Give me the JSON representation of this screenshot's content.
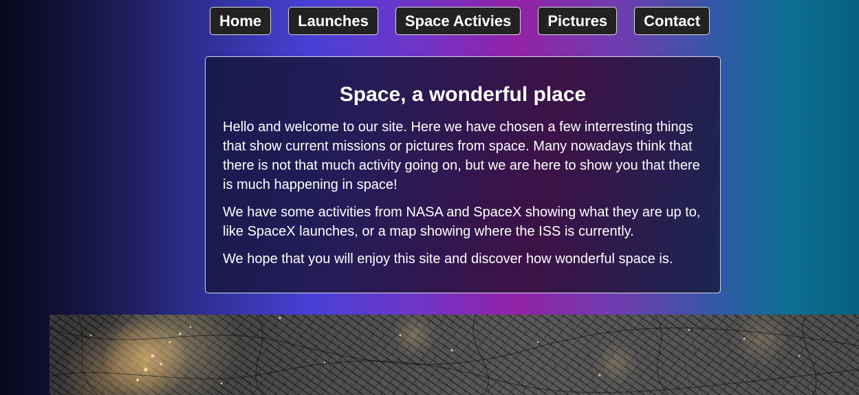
{
  "nav": {
    "items": [
      {
        "label": "Home"
      },
      {
        "label": "Launches"
      },
      {
        "label": "Space Activies"
      },
      {
        "label": "Pictures"
      },
      {
        "label": "Contact"
      }
    ]
  },
  "intro": {
    "title": "Space, a wonderful place",
    "paragraphs": [
      "Hello and welcome to our site. Here we have chosen a few interresting things that show current missions or pictures from space. Many nowadays think that there is not that much activity going on, but we are here to show you that there is much happening in space!",
      "We have some activities from NASA and SpaceX showing what they are up to, like SpaceX launches, or a map showing where the ISS is currently.",
      "We hope that you will enjoy this site and discover how wonderful space is."
    ]
  },
  "colors": {
    "nav_button_bg": "#222222",
    "card_border": "#d9d9e8",
    "text": "#ffffff"
  }
}
